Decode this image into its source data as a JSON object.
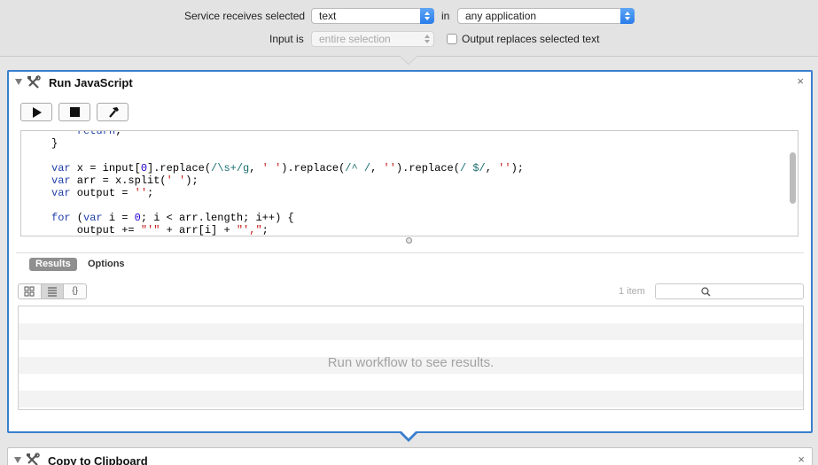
{
  "service": {
    "receives_label": "Service receives selected",
    "receives_value": "text",
    "in_label": "in",
    "in_value": "any application",
    "input_label": "Input is",
    "input_value": "entire selection",
    "output_checkbox_label": "Output replaces selected text",
    "output_checked": false
  },
  "action": {
    "title": "Run JavaScript",
    "close_symbol": "×",
    "toolbar": [
      "play-icon",
      "stop-icon",
      "hammer-icon"
    ],
    "code_lines": [
      "    return;",
      "}",
      "",
      "var x = input[0].replace(/\\s+/g, ' ').replace(/^ /, '').replace(/ $/, '');",
      "var arr = x.split(' ');",
      "var output = '';",
      "",
      "for (var i = 0; i < arr.length; i++) {",
      "    output += \"'\" + arr[i] + \"',\";"
    ],
    "tabs": {
      "results": "Results",
      "options": "Options"
    },
    "view_buttons": [
      "icon-view",
      "list-view",
      "code-view"
    ],
    "code_view_label": "{}",
    "item_count": "1 item",
    "empty_message": "Run workflow to see results."
  },
  "next_action": {
    "title": "Copy to Clipboard",
    "close_symbol": "×"
  },
  "colors": {
    "selection_border": "#3a7fcf",
    "popup_arrow": "#2a7cea",
    "keyword": "#1f3ea8",
    "string": "#c41a16"
  }
}
